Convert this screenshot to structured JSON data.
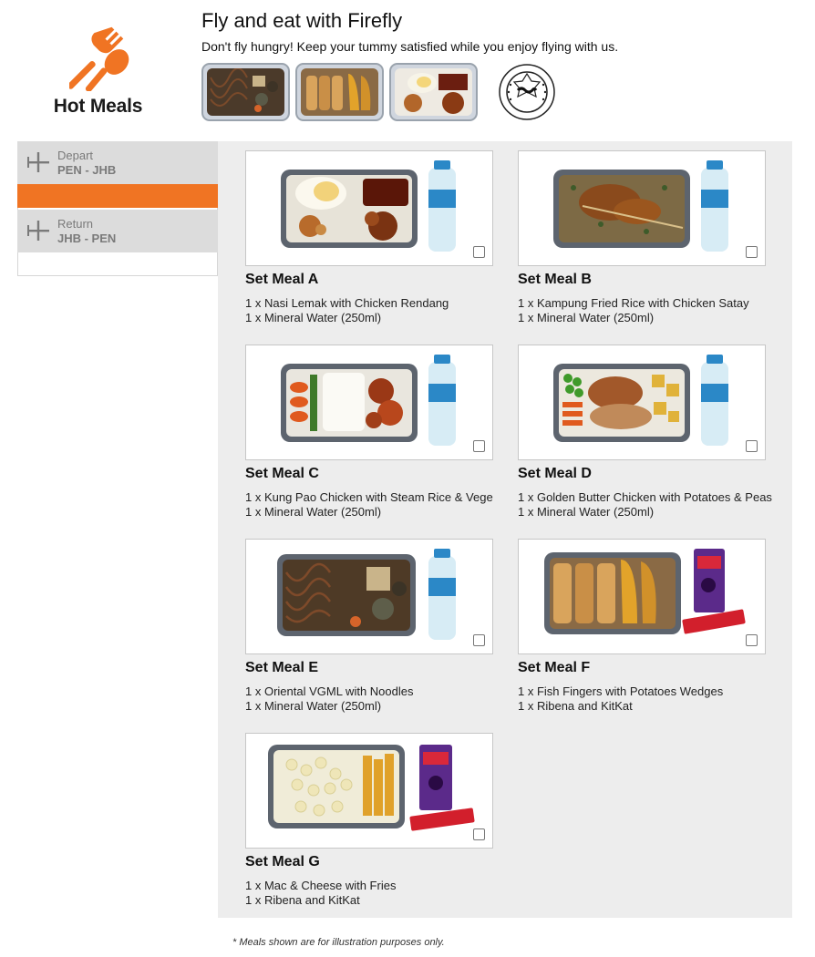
{
  "header": {
    "section_title": "Hot Meals",
    "title": "Fly and eat with Firefly",
    "subtitle": "Don't fly hungry! Keep your tummy satisfied while you enjoy flying with us.",
    "accent_color": "#f07423",
    "thumbnails": [
      "noodle-meal-photo",
      "fish-fingers-meal-photo",
      "nasi-lemak-meal-photo"
    ],
    "halal_logo": "halal-certification-logo"
  },
  "sidebar": {
    "segments": [
      {
        "label": "Depart",
        "route": "PEN - JHB",
        "icon": "plane-icon",
        "selected": true
      },
      {
        "label": "Return",
        "route": "JHB - PEN",
        "icon": "plane-icon",
        "selected": false
      }
    ]
  },
  "meals": [
    {
      "name": "Set Meal A",
      "items": [
        "1 x Nasi Lemak with Chicken Rendang",
        "1 x Mineral Water (250ml)"
      ],
      "drink": "water",
      "food": "nasi-lemak",
      "checked": false
    },
    {
      "name": "Set Meal B",
      "items": [
        "1 x Kampung Fried Rice with Chicken Satay",
        "1 x Mineral Water (250ml)"
      ],
      "drink": "water",
      "food": "fried-rice",
      "checked": false
    },
    {
      "name": "Set Meal C",
      "items": [
        "1 x Kung Pao Chicken with Steam Rice & Vege",
        "1 x Mineral Water (250ml)"
      ],
      "drink": "water",
      "food": "kung-pao",
      "checked": false
    },
    {
      "name": "Set Meal D",
      "items": [
        "1 x Golden Butter Chicken with Potatoes & Peas",
        "1 x Mineral Water (250ml)"
      ],
      "drink": "water",
      "food": "butter-chicken",
      "checked": false
    },
    {
      "name": "Set Meal E",
      "items": [
        "1 x Oriental VGML with Noodles",
        "1 x Mineral Water (250ml)"
      ],
      "drink": "water",
      "food": "noodles",
      "checked": false
    },
    {
      "name": "Set Meal F",
      "items": [
        "1 x Fish Fingers with Potatoes Wedges",
        "1 x Ribena and KitKat"
      ],
      "drink": "ribena",
      "food": "fish-fingers",
      "checked": false
    },
    {
      "name": "Set Meal G",
      "items": [
        "1 x Mac & Cheese with Fries",
        "1 x Ribena and KitKat"
      ],
      "drink": "ribena",
      "food": "mac-cheese",
      "checked": false
    }
  ],
  "footer": {
    "disclaimer": "* Meals shown are for illustration purposes only."
  }
}
